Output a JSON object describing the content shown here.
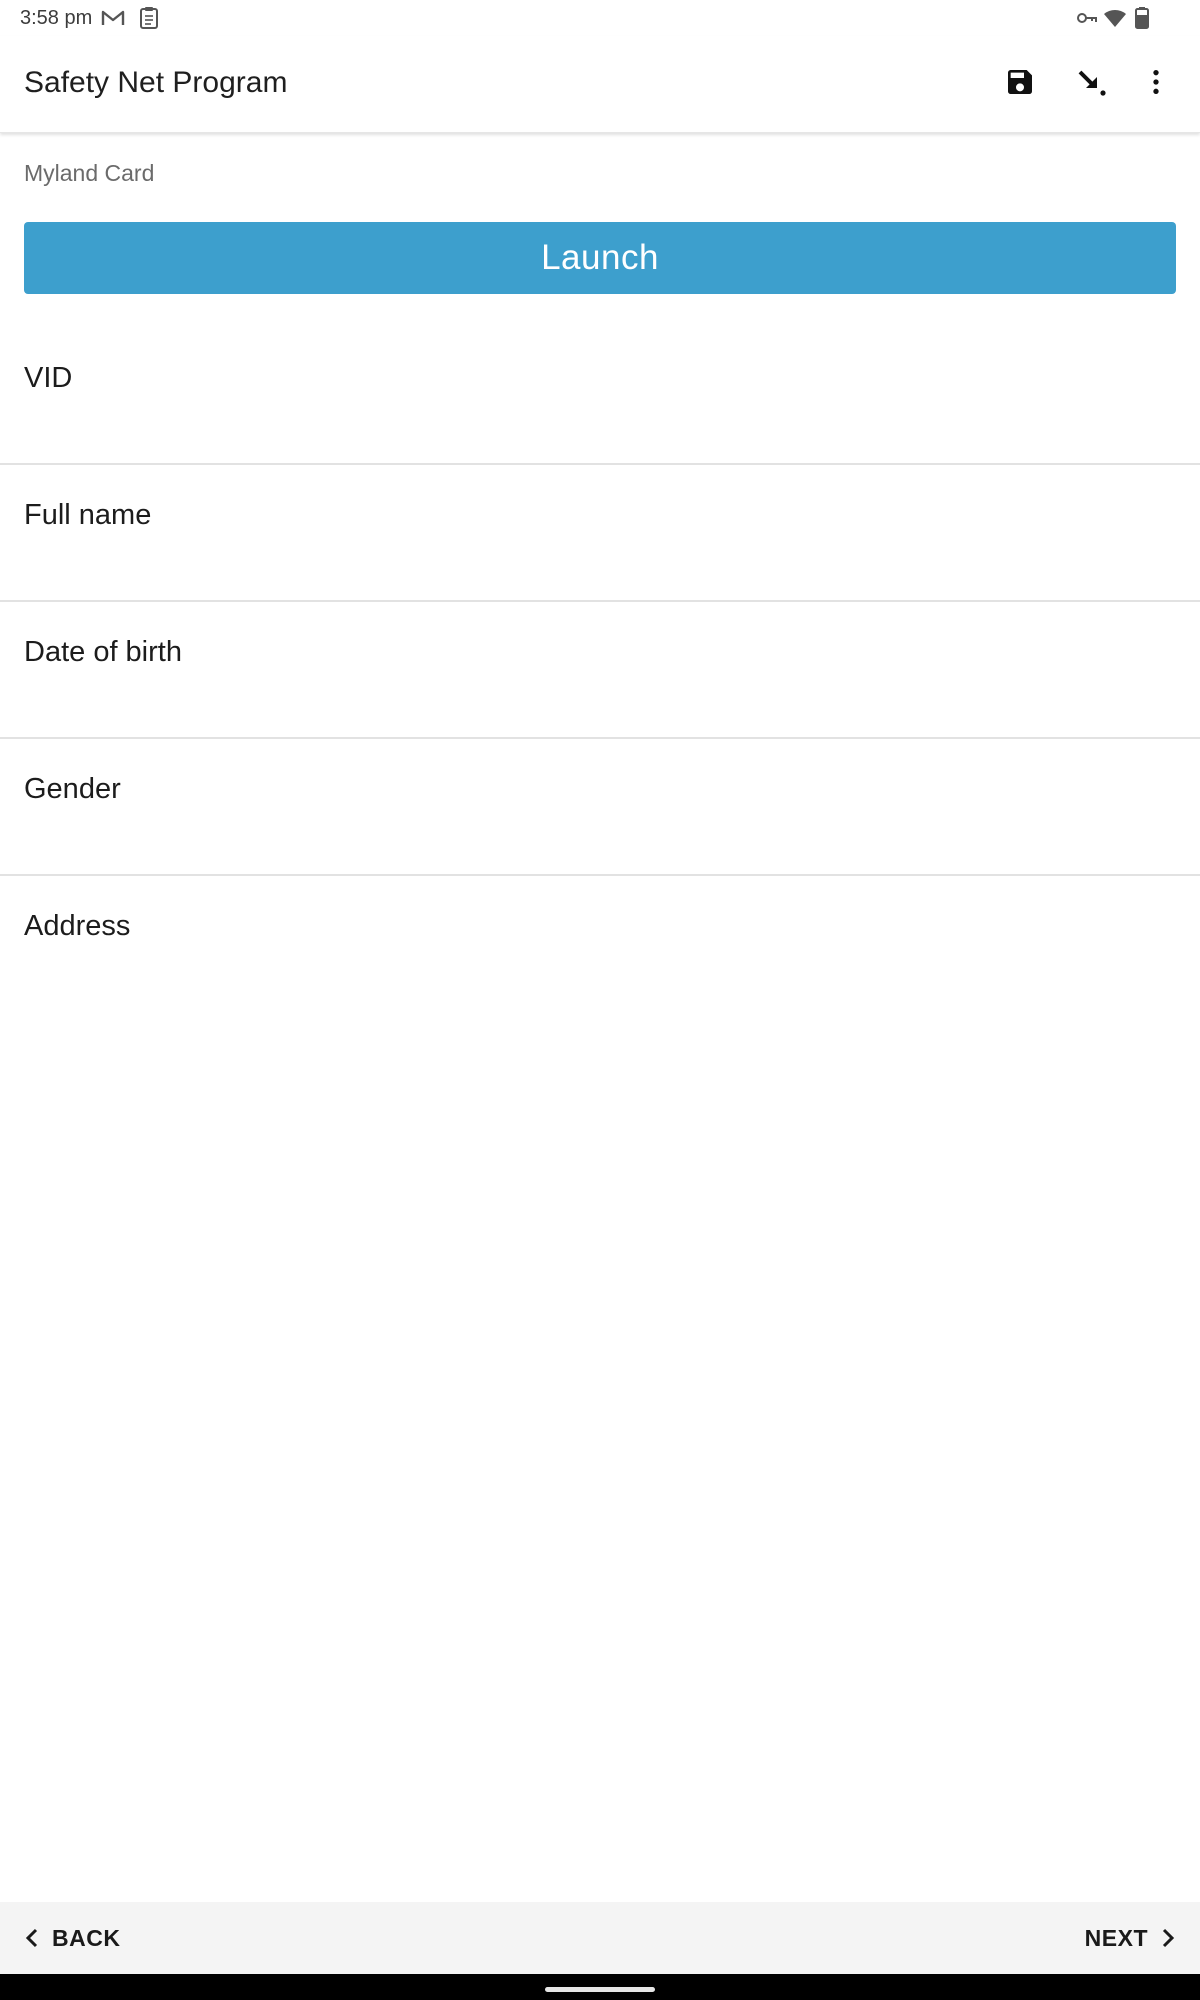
{
  "status_bar": {
    "time": "3:58 pm",
    "left_icons": [
      "gmail-icon",
      "clipboard-icon"
    ],
    "right_icons": [
      "vpn-key-icon",
      "wifi-icon",
      "battery-icon"
    ]
  },
  "app_bar": {
    "title": "Safety Net Program",
    "actions": [
      "save-icon",
      "jump-icon",
      "more-vert-icon"
    ]
  },
  "form": {
    "myland_label": "Myland Card",
    "launch_label": "Launch",
    "fields": [
      {
        "label": "VID"
      },
      {
        "label": "Full name"
      },
      {
        "label": "Date of birth"
      },
      {
        "label": "Gender"
      },
      {
        "label": "Address"
      }
    ]
  },
  "bottom_nav": {
    "back_label": "BACK",
    "next_label": "NEXT"
  },
  "colors": {
    "accent": "#3d9fcd",
    "bottom_bar_bg": "#f4f4f4"
  }
}
